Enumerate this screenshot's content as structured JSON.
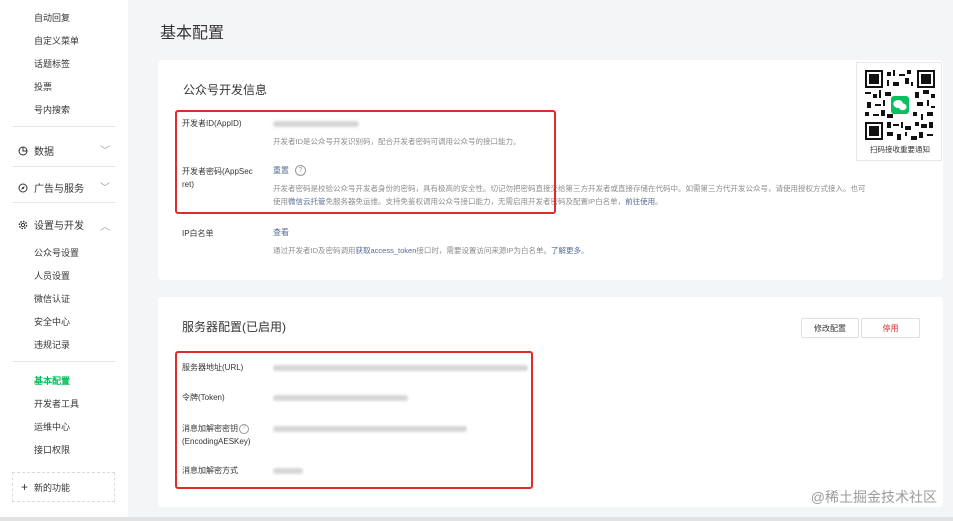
{
  "sidebar": {
    "top_items": [
      "自动回复",
      "自定义菜单",
      "话题标签",
      "投票",
      "号内搜索"
    ],
    "groups": [
      {
        "label": "数据",
        "icon": "data-icon",
        "chevron": "﹀"
      },
      {
        "label": "广告与服务",
        "icon": "compass-icon",
        "chevron": "﹀"
      },
      {
        "label": "设置与开发",
        "icon": "gear-icon",
        "chevron": "︿"
      }
    ],
    "settings_items": [
      "公众号设置",
      "人员设置",
      "微信认证",
      "安全中心",
      "违规记录"
    ],
    "dev_items": [
      "基本配置",
      "开发者工具",
      "运维中心",
      "接口权限"
    ],
    "active_item": "基本配置",
    "new_function": "新的功能",
    "plus": "+"
  },
  "page": {
    "title": "基本配置"
  },
  "dev_info": {
    "title": "公众号开发信息",
    "appid_label": "开发者ID(AppID)",
    "appid_desc": "开发者ID是公众号开发识别码，配合开发者密码可调用公众号的接口能力。",
    "secret_label_1": "开发者密码(AppSec",
    "secret_label_2": "ret)",
    "secret_reset": "重置",
    "help_glyph": "?",
    "secret_desc_1": "开发者密码是校验公众号开发者身份的密码，具有极高的安全性。切记勿把密码直接交给第三方开发者或直接存储在代码中。如需第三方代开发公众号，请使用授权方式接入。也可",
    "secret_desc_2a": "使用",
    "secret_desc_2_link": "微信云托管",
    "secret_desc_2b": "免服务器免运维。支持免鉴权调用公众号接口能力，无需启用开发者密码及配置IP白名单，",
    "secret_desc_2_link2": "前往使用",
    "secret_desc_2c": "。",
    "ip_label": "IP白名单",
    "ip_view": "查看",
    "ip_desc_a": "通过开发者ID及密码调用",
    "ip_desc_link": "获取access_token",
    "ip_desc_b": "接口时，需要设置访问来源IP为白名单。",
    "ip_desc_link2": "了解更多",
    "ip_desc_c": "。"
  },
  "server": {
    "title": "服务器配置(已启用)",
    "modify_button": "修改配置",
    "disable_button": "停用",
    "url_label": "服务器地址(URL)",
    "token_label": "令牌(Token)",
    "aes_label_1": "消息加解密密钥",
    "aes_label_2": "(EncodingAESKey)",
    "mode_label": "消息加解密方式"
  },
  "qr": {
    "caption": "扫码接收重要通知"
  },
  "watermark": "@稀土掘金技术社区",
  "colors": {
    "accent": "#07c160",
    "link": "#576b95",
    "danger": "#e02b2b",
    "highlight_box": "#e02b2b"
  }
}
